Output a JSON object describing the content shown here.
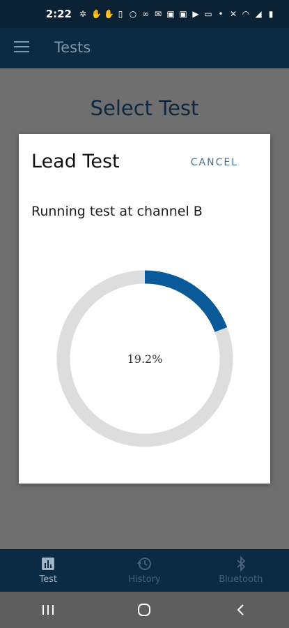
{
  "status_bar": {
    "time": "2:22"
  },
  "app_bar": {
    "title": "Tests",
    "menu_icon": "hamburger-menu-icon"
  },
  "page": {
    "title": "Select Test"
  },
  "dialog": {
    "title": "Lead Test",
    "cancel_label": "CANCEL",
    "message": "Running test at channel B",
    "progress": {
      "percent": 19.2,
      "label": "19.2%",
      "track_color": "#dddddd",
      "fill_color": "#0a5a9a"
    }
  },
  "bottom_nav": {
    "items": [
      {
        "label": "Test",
        "icon": "bar-chart-icon",
        "active": true
      },
      {
        "label": "History",
        "icon": "history-clock-icon",
        "active": false
      },
      {
        "label": "Bluetooth",
        "icon": "bluetooth-icon",
        "active": false
      }
    ]
  },
  "system_nav": {
    "buttons": [
      "recent-apps-icon",
      "home-icon",
      "back-icon"
    ]
  }
}
